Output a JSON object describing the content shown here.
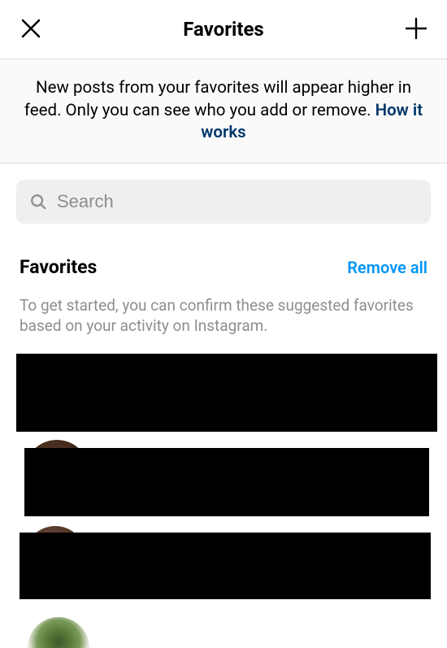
{
  "header": {
    "title": "Favorites"
  },
  "banner": {
    "text_prefix": "New posts from your favorites will appear higher in feed. Only you can see who you add or remove. ",
    "link_text": "How it works"
  },
  "search": {
    "placeholder": "Search"
  },
  "section": {
    "title": "Favorites",
    "remove_all_label": "Remove all",
    "description": "To get started, you can confirm these suggested favorites based on your activity on Instagram."
  }
}
